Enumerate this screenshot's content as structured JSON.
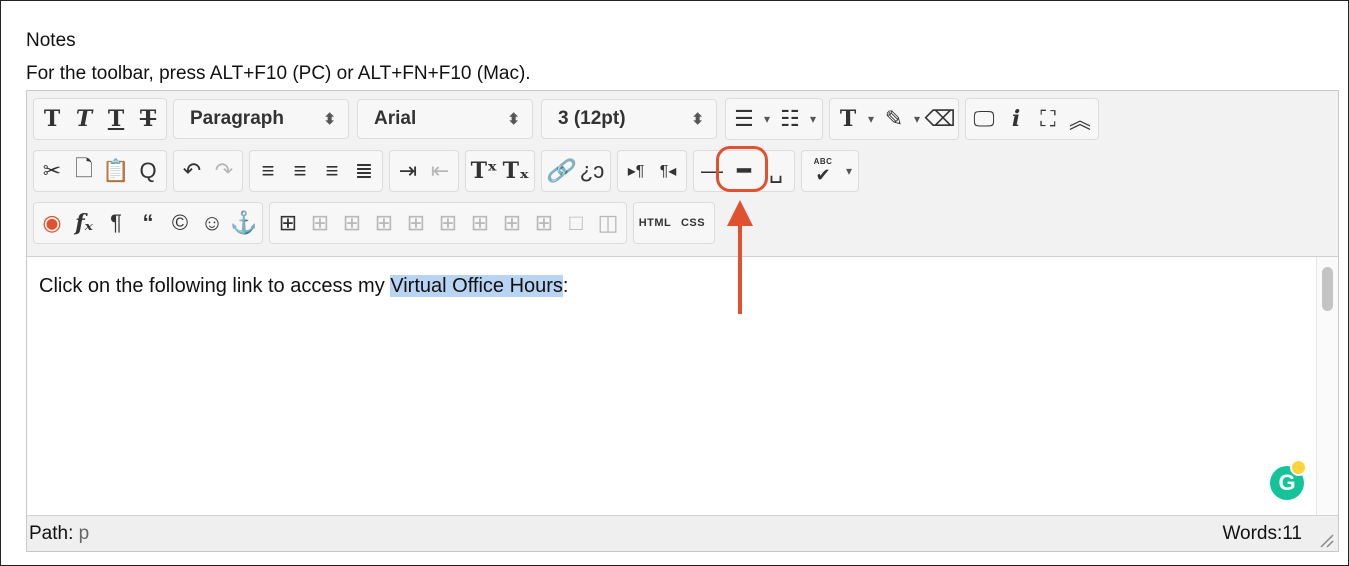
{
  "field": {
    "label": "Notes",
    "hint": "For the toolbar, press ALT+F10 (PC) or ALT+FN+F10 (Mac)."
  },
  "toolbar": {
    "paragraph_select": "Paragraph",
    "font_select": "Arial",
    "size_select": "3 (12pt)",
    "html_label": "HTML",
    "css_label": "CSS",
    "spellcheck_label": "ABC"
  },
  "content": {
    "before": "Click on the following link to access my ",
    "selected": "Virtual Office Hours",
    "after": ":"
  },
  "status": {
    "path_label": "Path:",
    "path_value": "p",
    "words": "Words:11"
  },
  "grammarly": {
    "letter": "G"
  },
  "colors": {
    "annotation": "#e0522f",
    "selection": "#b9d4f3",
    "grammarly": "#15c39a"
  },
  "icons": {
    "row1": [
      "bold-icon",
      "italic-icon",
      "underline-icon",
      "strikethrough-icon",
      "bullet-list-icon",
      "numbered-list-icon",
      "text-color-icon",
      "highlight-icon",
      "eraser-icon",
      "preview-icon",
      "info-icon",
      "fullscreen-icon",
      "collapse-icon"
    ],
    "row2": [
      "cut-icon",
      "copy-icon",
      "paste-icon",
      "find-icon",
      "undo-icon",
      "redo-icon",
      "align-left-icon",
      "align-center-icon",
      "align-right-icon",
      "justify-icon",
      "indent-icon",
      "outdent-icon",
      "superscript-icon",
      "subscript-icon",
      "link-icon",
      "unlink-icon",
      "ltr-icon",
      "rtl-icon",
      "horizontal-rule-icon",
      "thick-rule-icon",
      "nbsp-icon",
      "spellcheck-icon"
    ],
    "row3": [
      "mashup-icon",
      "math-icon",
      "pilcrow-icon",
      "blockquote-icon",
      "copyright-icon",
      "emoticon-icon",
      "anchor-icon",
      "table-icon"
    ]
  }
}
